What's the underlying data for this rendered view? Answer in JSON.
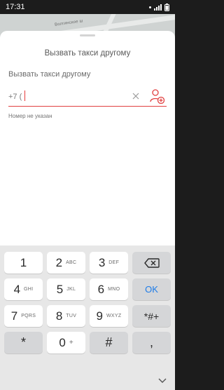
{
  "status_bar": {
    "time": "17:31"
  },
  "map": {
    "street_label": "Волгинское ш"
  },
  "sheet": {
    "title": "Вызвать такси другому",
    "field_label": "Вызвать такси другому",
    "phone_prefix": "+7 (",
    "clear_icon": "close-icon",
    "contact_icon": "add-contact-icon",
    "error_text": "Номер не указан",
    "accent_color": "#e14040"
  },
  "keyboard": {
    "keys": [
      {
        "main": "1",
        "sub": ""
      },
      {
        "main": "2",
        "sub": "ABC"
      },
      {
        "main": "3",
        "sub": "DEF"
      },
      {
        "main": "⌫",
        "sub": ""
      },
      {
        "main": "4",
        "sub": "GHI"
      },
      {
        "main": "5",
        "sub": "JKL"
      },
      {
        "main": "6",
        "sub": "MNO"
      },
      {
        "main": "OK",
        "sub": ""
      },
      {
        "main": "7",
        "sub": "PQRS"
      },
      {
        "main": "8",
        "sub": "TUV"
      },
      {
        "main": "9",
        "sub": "WXYZ"
      },
      {
        "main": "*#+",
        "sub": ""
      },
      {
        "main": "*",
        "sub": ""
      },
      {
        "main": "0",
        "sub": "+"
      },
      {
        "main": "#",
        "sub": ""
      },
      {
        "main": ",",
        "sub": ""
      }
    ],
    "ok_color": "#1e7ce8"
  },
  "nav": {
    "hide_keyboard_icon": "chevron-down-icon"
  }
}
